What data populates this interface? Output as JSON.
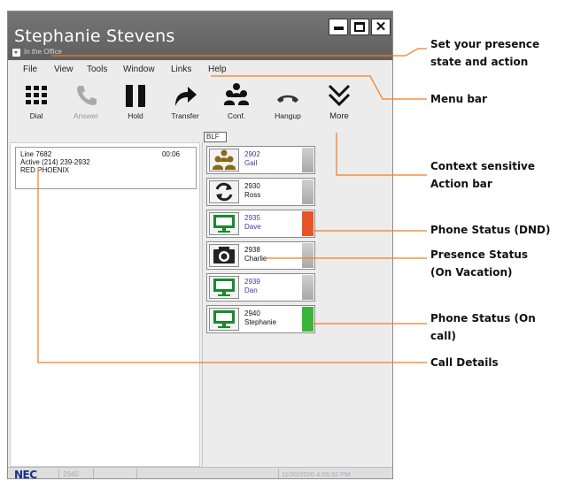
{
  "window": {
    "user_name": "Stephanie Stevens",
    "presence": "In the Office"
  },
  "menu": [
    "File",
    "View",
    "Tools",
    "Window",
    "Links",
    "Help"
  ],
  "toolbar": [
    {
      "label": "Dial",
      "icon": "dialpad-icon",
      "enabled": true
    },
    {
      "label": "Answer",
      "icon": "handset-icon",
      "enabled": false
    },
    {
      "label": "Hold",
      "icon": "pause-icon",
      "enabled": true
    },
    {
      "label": "Transfer",
      "icon": "transfer-arrow-icon",
      "enabled": true
    },
    {
      "label": "Conf.",
      "icon": "conference-icon",
      "enabled": true
    },
    {
      "label": "Hangup",
      "icon": "hangup-icon",
      "enabled": true
    },
    {
      "label": "More",
      "icon": "chevron-double-down-icon",
      "enabled": true
    }
  ],
  "blf_tab": "BLF",
  "call": {
    "line": "Line 7682",
    "timer": "00:06",
    "status": "Active (214) 239-2932",
    "caller": "RED PHOENIX"
  },
  "blf": [
    {
      "ext": "2902",
      "name": "Gail",
      "icon": "people-icon",
      "text_color": "#3a3aa8",
      "strip": "none"
    },
    {
      "ext": "2930",
      "name": "Ross",
      "icon": "refresh-icon",
      "text_color": "#111111",
      "strip": "none"
    },
    {
      "ext": "2935",
      "name": "Dave",
      "icon": "monitor-icon",
      "text_color": "#3a3aa8",
      "strip": "#e8542a"
    },
    {
      "ext": "2938",
      "name": "Charlie",
      "icon": "camera-icon",
      "text_color": "#111111",
      "strip": "none"
    },
    {
      "ext": "2939",
      "name": "Dan",
      "icon": "monitor-icon",
      "text_color": "#3a3aa8",
      "strip": "none"
    },
    {
      "ext": "2940",
      "name": "Stephanie",
      "icon": "monitor-icon",
      "text_color": "#111111",
      "strip": "#3cb43c"
    }
  ],
  "statusbar": {
    "brand": "NEC",
    "extension": "2940",
    "datetime": "11/20/2020 4:05:32 PM"
  },
  "annotations": {
    "presence": "Set your presence state and action",
    "menu": "Menu bar",
    "action": "Context sensitive Action bar",
    "dnd": "Phone Status (DND)",
    "vacation": "Presence Status (On Vacation)",
    "oncall": "Phone Status (On call)",
    "details": "Call Details"
  },
  "colors": {
    "accent_orange": "#f47b20",
    "monitor_green": "#178a2e",
    "presence_brown": "#8a6a1a",
    "dnd_red": "#e8542a",
    "oncall_green": "#3cb43c"
  }
}
